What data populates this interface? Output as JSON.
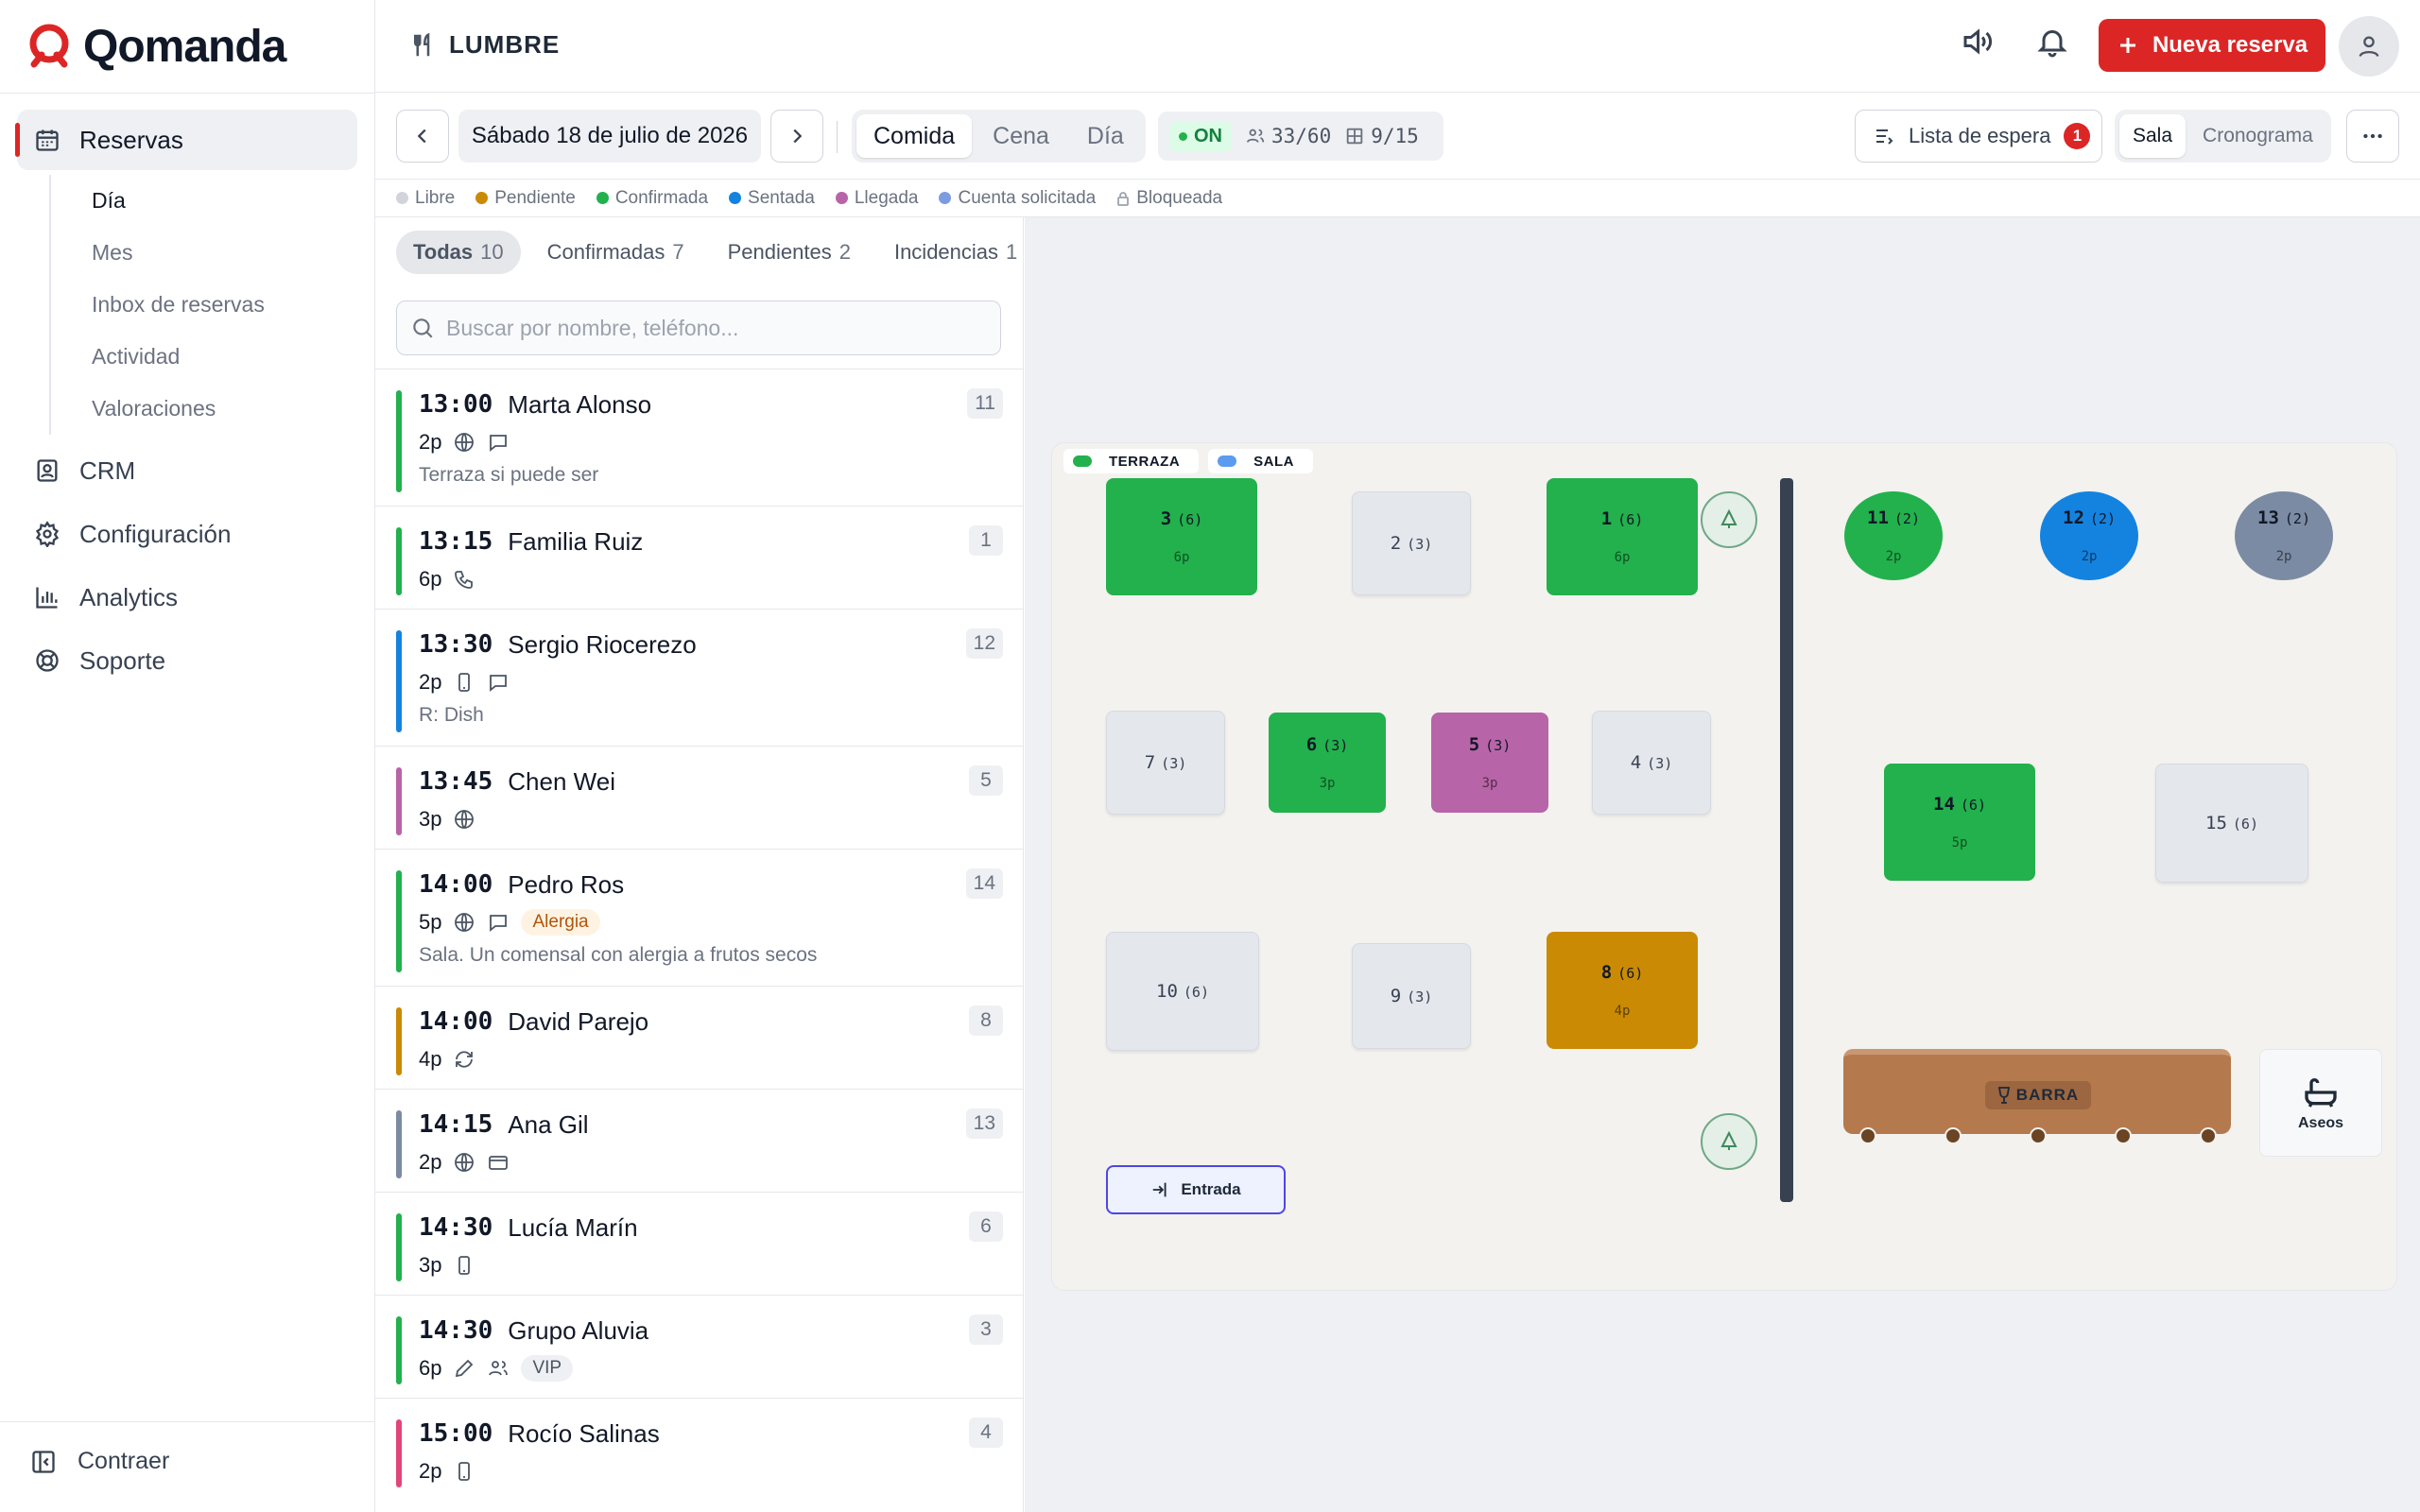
{
  "app": {
    "name": "Qomanda",
    "venue": "LUMBRE",
    "new_booking_label": "Nueva reserva"
  },
  "sidebar": {
    "items": [
      {
        "label": "Reservas",
        "icon": "calendar-icon"
      },
      {
        "label": "CRM",
        "icon": "contact-icon"
      },
      {
        "label": "Configuración",
        "icon": "gear-icon"
      },
      {
        "label": "Analytics",
        "icon": "chart-icon"
      },
      {
        "label": "Soporte",
        "icon": "lifebuoy-icon"
      }
    ],
    "subitems": [
      "Día",
      "Mes",
      "Inbox de reservas",
      "Actividad",
      "Valoraciones"
    ],
    "collapse_label": "Contraer"
  },
  "toolbar": {
    "date": "Sábado 18 de julio de 2026",
    "services": [
      "Comida",
      "Cena",
      "Día"
    ],
    "status": {
      "on_label": "ON",
      "guests": "33/60",
      "tables": "9/15"
    },
    "waitlist_label": "Lista de espera",
    "waitlist_count": "1",
    "views": [
      "Sala",
      "Cronograma"
    ]
  },
  "legend": [
    {
      "label": "Libre",
      "color": "#d1d5db"
    },
    {
      "label": "Pendiente",
      "color": "#ca8a04"
    },
    {
      "label": "Confirmada",
      "color": "#22b14c"
    },
    {
      "label": "Sentada",
      "color": "#1483e0"
    },
    {
      "label": "Llegada",
      "color": "#b864a8"
    },
    {
      "label": "Cuenta solicitada",
      "color": "#7c9be0"
    },
    {
      "label": "Bloqueada",
      "color": "#9ca3af"
    }
  ],
  "filters": [
    {
      "label": "Todas",
      "count": "10"
    },
    {
      "label": "Confirmadas",
      "count": "7"
    },
    {
      "label": "Pendientes",
      "count": "2"
    },
    {
      "label": "Incidencias",
      "count": "1"
    }
  ],
  "search": {
    "placeholder": "Buscar por nombre, teléfono..."
  },
  "reservations": [
    {
      "time": "13:00",
      "name": "Marta Alonso",
      "party": "2p",
      "table": "11",
      "note": "Terraza si puede ser",
      "color": "#22b14c",
      "icons": [
        "globe-icon",
        "chat-icon"
      ],
      "tag": ""
    },
    {
      "time": "13:15",
      "name": "Familia Ruiz",
      "party": "6p",
      "table": "1",
      "note": "",
      "color": "#22b14c",
      "icons": [
        "phone-icon"
      ],
      "tag": ""
    },
    {
      "time": "13:30",
      "name": "Sergio Riocerezo",
      "party": "2p",
      "table": "12",
      "note": "R: Dish",
      "color": "#1483e0",
      "icons": [
        "mobile-icon",
        "chat-icon"
      ],
      "tag": ""
    },
    {
      "time": "13:45",
      "name": "Chen Wei",
      "party": "3p",
      "table": "5",
      "note": "",
      "color": "#b864a8",
      "icons": [
        "globe-icon"
      ],
      "tag": ""
    },
    {
      "time": "14:00",
      "name": "Pedro Ros",
      "party": "5p",
      "table": "14",
      "note": "Sala. Un comensal con alergia a frutos secos",
      "color": "#22b14c",
      "icons": [
        "globe-icon",
        "chat-icon"
      ],
      "tag": "Alergia"
    },
    {
      "time": "14:00",
      "name": "David Parejo",
      "party": "4p",
      "table": "8",
      "note": "",
      "color": "#ca8a04",
      "icons": [
        "repeat-icon"
      ],
      "tag": ""
    },
    {
      "time": "14:15",
      "name": "Ana Gil",
      "party": "2p",
      "table": "13",
      "note": "",
      "color": "#7b8ba3",
      "icons": [
        "globe-icon",
        "card-icon"
      ],
      "tag": ""
    },
    {
      "time": "14:30",
      "name": "Lucía Marín",
      "party": "3p",
      "table": "6",
      "note": "",
      "color": "#22b14c",
      "icons": [
        "mobile-icon"
      ],
      "tag": ""
    },
    {
      "time": "14:30",
      "name": "Grupo Aluvia",
      "party": "6p",
      "table": "3",
      "note": "",
      "color": "#22b14c",
      "icons": [
        "pencil-icon",
        "users-icon"
      ],
      "tag": "VIP"
    },
    {
      "time": "15:00",
      "name": "Rocío Salinas",
      "party": "2p",
      "table": "4",
      "note": "",
      "color": "#e2457a",
      "icons": [
        "mobile-icon"
      ],
      "tag": ""
    }
  ],
  "floor": {
    "zones": [
      {
        "label": "TERRAZA",
        "color": "#22b14c"
      },
      {
        "label": "SALA",
        "color": "#5b9bf0"
      }
    ],
    "tables": [
      {
        "id": "3",
        "cap": "(6)",
        "guests": "6p",
        "state": "confirmada"
      },
      {
        "id": "2",
        "cap": "(3)",
        "guests": "",
        "state": "libre"
      },
      {
        "id": "1",
        "cap": "(6)",
        "guests": "6p",
        "state": "confirmada"
      },
      {
        "id": "7",
        "cap": "(3)",
        "guests": "",
        "state": "libre"
      },
      {
        "id": "6",
        "cap": "(3)",
        "guests": "3p",
        "state": "confirmada"
      },
      {
        "id": "5",
        "cap": "(3)",
        "guests": "3p",
        "state": "llegada"
      },
      {
        "id": "4",
        "cap": "(3)",
        "guests": "",
        "state": "libre"
      },
      {
        "id": "10",
        "cap": "(6)",
        "guests": "",
        "state": "libre"
      },
      {
        "id": "9",
        "cap": "(3)",
        "guests": "",
        "state": "libre"
      },
      {
        "id": "8",
        "cap": "(6)",
        "guests": "4p",
        "state": "pendiente"
      },
      {
        "id": "11",
        "cap": "(2)",
        "guests": "2p",
        "state": "confirmada"
      },
      {
        "id": "12",
        "cap": "(2)",
        "guests": "2p",
        "state": "sentada"
      },
      {
        "id": "13",
        "cap": "(2)",
        "guests": "2p",
        "state": "cuenta"
      },
      {
        "id": "14",
        "cap": "(6)",
        "guests": "5p",
        "state": "confirmada"
      },
      {
        "id": "15",
        "cap": "(6)",
        "guests": "",
        "state": "libre"
      }
    ],
    "entrance_label": "Entrada",
    "bar_label": "BARRA",
    "restroom_label": "Aseos"
  }
}
